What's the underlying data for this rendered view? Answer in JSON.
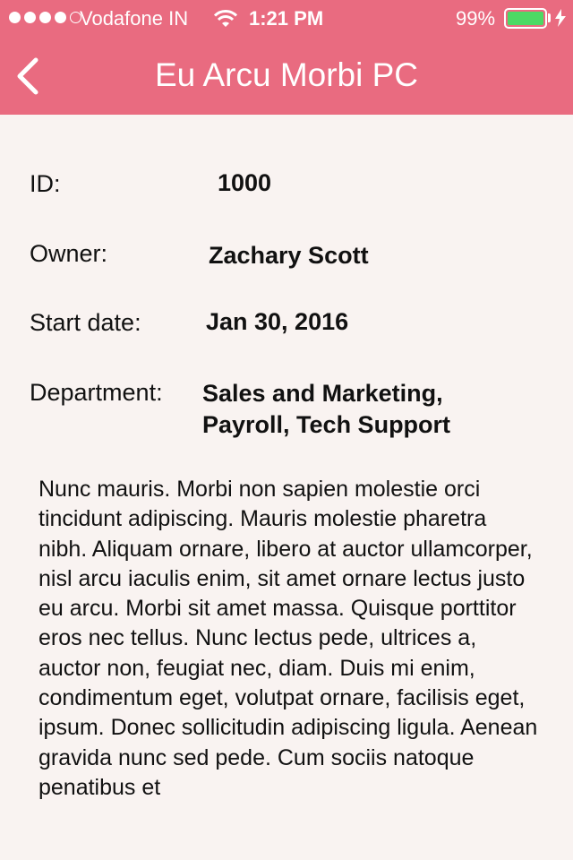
{
  "status_bar": {
    "carrier": "Vodafone IN",
    "time": "1:21 PM",
    "battery_percent": "99%",
    "signal_bars_filled": 4,
    "signal_bars_total": 5,
    "battery_level": 0.99
  },
  "nav": {
    "title": "Eu Arcu Morbi PC",
    "back_icon": "chevron-left-icon"
  },
  "details": {
    "id_label": "ID:",
    "id_value": "1000",
    "owner_label": "Owner:",
    "owner_value": "Zachary Scott",
    "start_label": "Start date:",
    "start_value": "Jan 30, 2016",
    "dept_label": "Department:",
    "dept_value_line1": "Sales and Marketing,",
    "dept_value_line2": "Payroll, Tech Support"
  },
  "description": "Nunc mauris. Morbi non sapien molestie orci tincidunt adipiscing. Mauris molestie pharetra nibh. Aliquam ornare, libero at auctor ullamcorper, nisl arcu iaculis enim, sit amet ornare lectus justo eu arcu. Morbi sit amet massa. Quisque porttitor eros nec tellus. Nunc lectus pede, ultrices a, auctor non, feugiat nec, diam. Duis mi enim, condimentum eget, volutpat ornare, facilisis eget, ipsum. Donec sollicitudin adipiscing ligula. Aenean gravida nunc sed pede. Cum sociis natoque penatibus et",
  "colors": {
    "header": "#e96b80",
    "background": "#f9f3f1",
    "battery": "#4cd964"
  }
}
